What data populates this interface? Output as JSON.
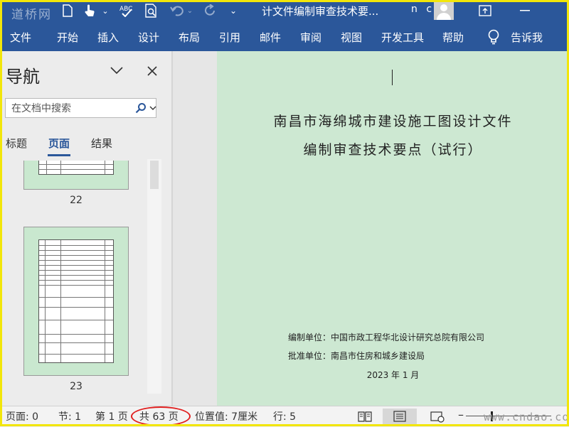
{
  "titlebar": {
    "watermark": "道桥网",
    "doc_title": "计文件编制审查技术要...",
    "user": "n c"
  },
  "ribbon": {
    "tabs": [
      "文件",
      "开始",
      "插入",
      "设计",
      "布局",
      "引用",
      "邮件",
      "审阅",
      "视图",
      "开发工具",
      "帮助",
      "告诉我"
    ]
  },
  "nav": {
    "title": "导航",
    "search_placeholder": "在文档中搜索",
    "tabs": [
      "标题",
      "页面",
      "结果"
    ],
    "active_tab": "页面",
    "thumbnails": [
      {
        "label": "22"
      },
      {
        "label": "23"
      }
    ]
  },
  "document": {
    "title_line1": "南昌市海绵城市建设施工图设计文件",
    "title_line2": "编制审查技术要点（试行）",
    "compiler": "编制单位：中国市政工程华北设计研究总院有限公司",
    "approver": "批准单位：南昌市住房和城乡建设局",
    "date": "2023 年 1 月"
  },
  "status": {
    "page": "页面: 0",
    "section": "节: 1",
    "page_of": "第 1 页",
    "total_pages": "共 63 页",
    "position": "位置值: 7厘米",
    "line": "行: 5",
    "watermark": "www.cndao.com"
  },
  "colors": {
    "ribbon": "#2b579a",
    "page_background": "#cde8d2",
    "highlight_oval": "#e02020",
    "frame": "#f2e60a"
  }
}
